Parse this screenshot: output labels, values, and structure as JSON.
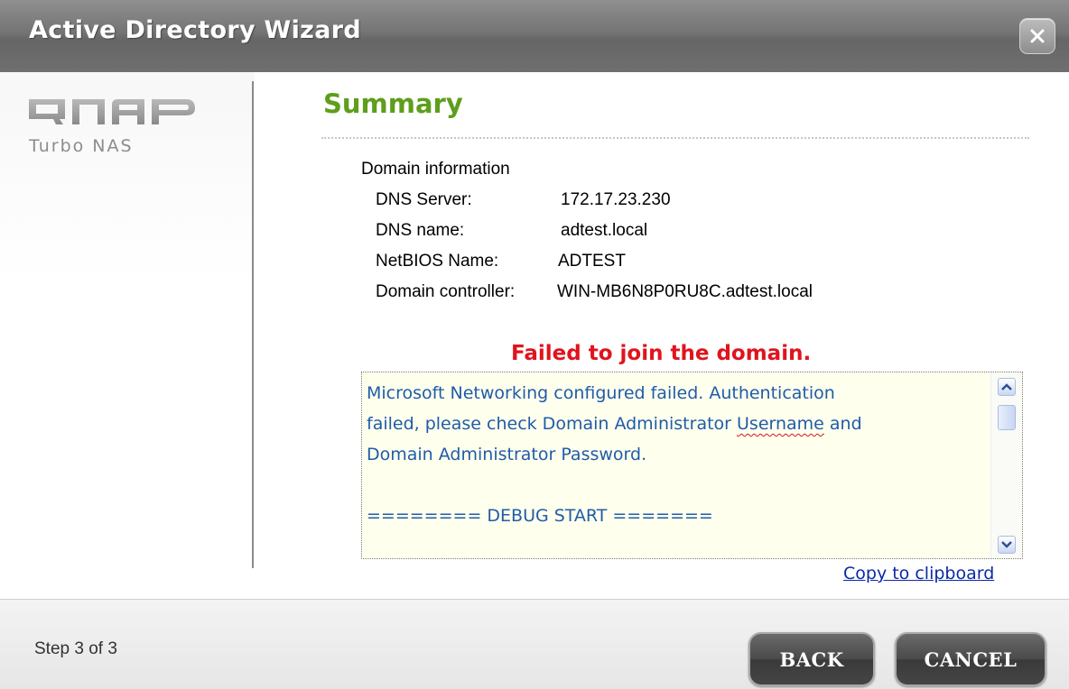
{
  "window": {
    "title": "Active Directory Wizard",
    "close_icon": "close-x-icon"
  },
  "brand": {
    "logo_text": "QNAP",
    "tagline": "Turbo NAS"
  },
  "summary": {
    "heading": "Summary",
    "section_title": "Domain information",
    "rows": [
      {
        "label": "DNS Server:",
        "value": "172.17.23.230"
      },
      {
        "label": "DNS name:",
        "value": "adtest.local"
      },
      {
        "label": "NetBIOS Name:",
        "value": "ADTEST"
      },
      {
        "label": "Domain controller:",
        "value": "WIN-MB6N8P0RU8C.adtest.local"
      }
    ]
  },
  "status": {
    "message": "Failed to join the domain.",
    "color": "#e0141e"
  },
  "log": {
    "line1": "Microsoft Networking configured failed. Authentication",
    "line2_before": "failed, please check Domain Administrator ",
    "line2_flagged": "Username",
    "line2_after": " and",
    "line3": "Domain Administrator Password.",
    "line5": "======== DEBUG START =======",
    "text_color": "#1f5ca8"
  },
  "copy_link": "Copy to clipboard",
  "footer": {
    "step": "Step 3 of 3",
    "back_label": "BACK",
    "cancel_label": "CANCEL"
  },
  "colors": {
    "heading": "#5e9e1c",
    "titlebar": "#747474",
    "link": "#0a2aa6"
  }
}
